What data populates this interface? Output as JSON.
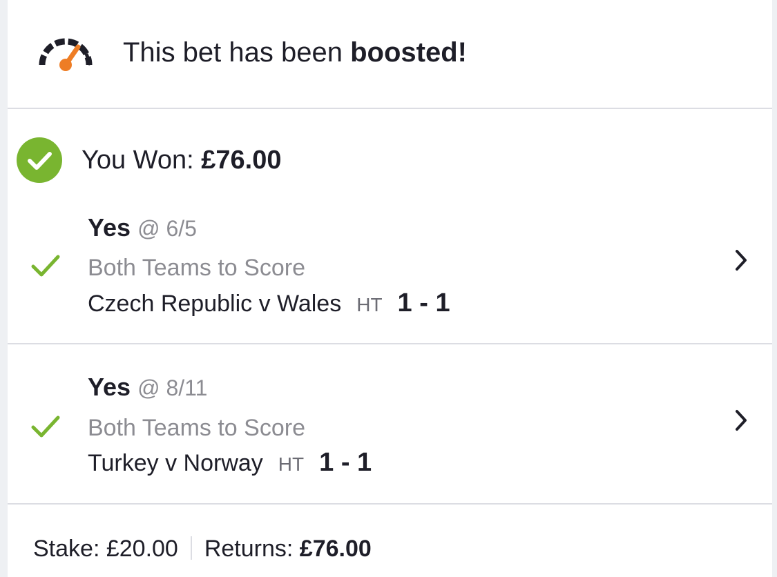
{
  "header": {
    "icon": "speedometer-boost-icon",
    "text_prefix": "This bet has been ",
    "text_bold": "boosted!"
  },
  "result": {
    "icon": "check-circle-icon",
    "label": "You Won: ",
    "amount": "£76.00",
    "color": "#79b530"
  },
  "selections": [
    {
      "pick": "Yes",
      "odds": "@ 6/5",
      "market": "Both Teams to Score",
      "event": "Czech Republic v Wales",
      "period": "HT",
      "score": "1 - 1",
      "status_icon": "check-icon"
    },
    {
      "pick": "Yes",
      "odds": "@ 8/11",
      "market": "Both Teams to Score",
      "event": "Turkey v Norway",
      "period": "HT",
      "score": "1 - 1",
      "status_icon": "check-icon"
    }
  ],
  "footer": {
    "stake_label": "Stake: ",
    "stake_value": "£20.00",
    "returns_label": "Returns: ",
    "returns_value": "£76.00"
  },
  "colors": {
    "accent_orange": "#ee7d25",
    "success_green": "#79b530",
    "text_dark": "#1e1e28",
    "text_muted": "#8c8c92"
  }
}
